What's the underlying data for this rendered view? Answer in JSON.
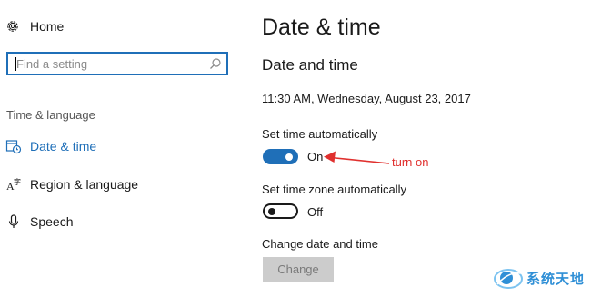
{
  "sidebar": {
    "home_label": "Home",
    "home_icon": "gear-icon",
    "search_placeholder": "Find a setting",
    "search_icon": "search-icon",
    "section_label": "Time & language",
    "items": [
      {
        "label": "Date & time",
        "icon": "clock-icon",
        "active": true
      },
      {
        "label": "Region & language",
        "icon": "region-language-icon",
        "active": false
      },
      {
        "label": "Speech",
        "icon": "microphone-icon",
        "active": false
      }
    ]
  },
  "main": {
    "title": "Date & time",
    "subtitle": "Date and time",
    "current_time": "11:30 AM, Wednesday, August 23, 2017",
    "set_time_auto": {
      "label": "Set time automatically",
      "state": "On",
      "on": true
    },
    "set_zone_auto": {
      "label": "Set time zone automatically",
      "state": "Off",
      "on": false
    },
    "change": {
      "label": "Change date and time",
      "button": "Change",
      "enabled": false
    }
  },
  "annotation": {
    "text": "turn on",
    "color": "#e0302e"
  },
  "watermark": {
    "text": "系统天地",
    "color": "#2f8fd6"
  },
  "colors": {
    "accent": "#1f6fb8",
    "disabled_button": "#cccccc"
  }
}
